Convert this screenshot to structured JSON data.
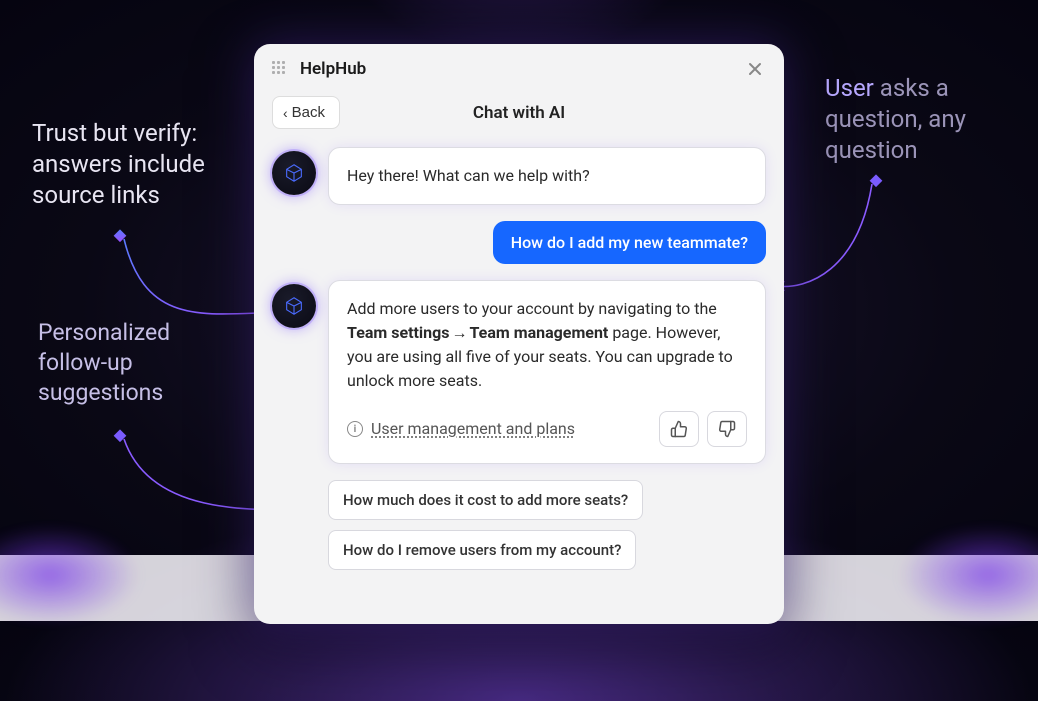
{
  "header": {
    "app_name": "HelpHub"
  },
  "subheader": {
    "back_label": "Back",
    "title": "Chat with AI"
  },
  "messages": {
    "ai_greeting": "Hey there! What can we help with?",
    "user_question": "How do I add my new teammate?",
    "ai_answer_part1": "Add more users to your account by navigating to the ",
    "ai_answer_bold1": "Team settings",
    "ai_answer_arrow": "→",
    "ai_answer_bold2": "Team management",
    "ai_answer_part2": " page. However, you are using all five of your seats. You can upgrade to unlock more seats.",
    "source_link": "User management and plans"
  },
  "suggestions": [
    "How much does it cost to add more seats?",
    "How do I remove users from my account?"
  ],
  "callouts": {
    "left1": "Trust but verify: answers include source links",
    "left2": "Personalized follow-up suggestions",
    "right_highlight": "User",
    "right_rest": " asks a question, ",
    "right_rest2": "any question"
  }
}
